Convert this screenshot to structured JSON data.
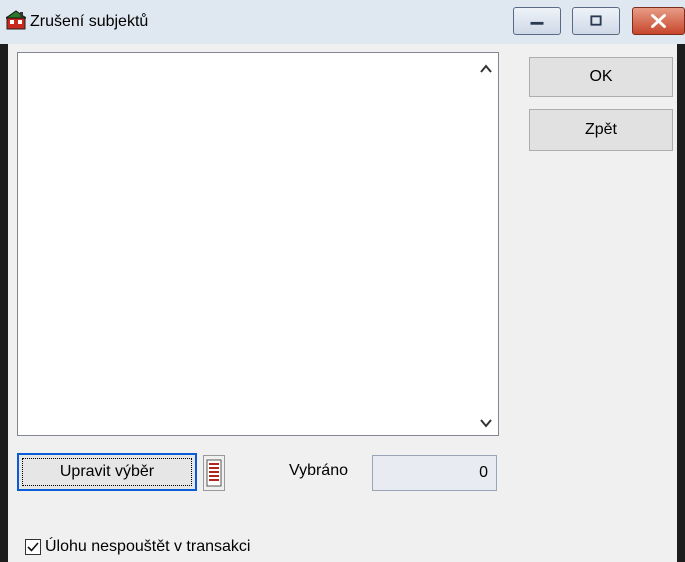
{
  "window": {
    "title": "Zrušení subjektů"
  },
  "caption_buttons": {
    "minimize": "minimize-icon",
    "maximize": "maximize-icon",
    "close": "close-icon"
  },
  "buttons": {
    "ok_label": "OK",
    "back_label": "Zpět",
    "edit_selection_label": "Upravit výběr"
  },
  "selection": {
    "label": "Vybráno",
    "value": "0"
  },
  "options": {
    "no_transaction_label": "Úlohu nespouštět v transakci",
    "no_transaction_checked": true
  },
  "icons": {
    "app": "app-house-icon",
    "list": "list-icon",
    "scroll_up": "chevron-up-icon",
    "scroll_down": "chevron-down-icon",
    "check": "checkmark-icon"
  },
  "colors": {
    "focus_border": "#0a5bd6",
    "close_button": "#c7462c",
    "titlebar": "#dfe8f1"
  }
}
